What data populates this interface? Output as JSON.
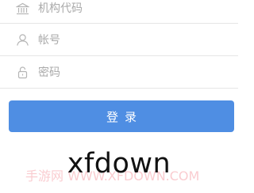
{
  "form": {
    "org_code": {
      "placeholder": "机构代码",
      "icon": "bank-icon"
    },
    "account": {
      "placeholder": "帐号",
      "icon": "user-icon"
    },
    "password": {
      "placeholder": "密码",
      "icon": "lock-icon"
    },
    "login_label": "登录"
  },
  "watermark": {
    "main_text": "xfdown",
    "faint_text": "手游网 WWW.XFDOWN.COM"
  },
  "colors": {
    "button_bg": "#4f8ee3",
    "divider": "#e6e6e6",
    "placeholder": "#aaaaaa",
    "icon": "#b5b5b5"
  }
}
